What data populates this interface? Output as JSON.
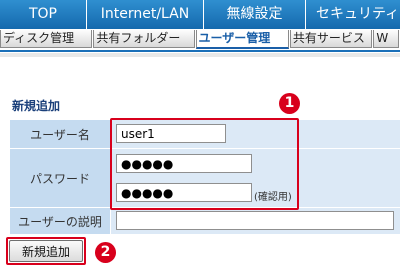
{
  "top_nav": {
    "tabs": [
      "TOP",
      "Internet/LAN",
      "無線設定",
      "セキュリティ"
    ]
  },
  "sub_nav": {
    "tabs": [
      "ディスク管理",
      "共有フォルダー",
      "ユーザー管理",
      "共有サービス",
      "W"
    ],
    "active": "ユーザー管理"
  },
  "section": {
    "title": "新規追加"
  },
  "form": {
    "username_label": "ユーザー名",
    "username_value": "user1",
    "password_label": "パスワード",
    "password_value": "●●●●●",
    "password_confirm_value": "●●●●●",
    "password_confirm_hint": "(確認用)",
    "description_label": "ユーザーの説明",
    "description_value": "",
    "submit_label": "新規追加"
  },
  "annotations": {
    "badge_1": "1",
    "badge_2": "2",
    "highlight_color": "#d8001c"
  },
  "colors": {
    "nav_blue": "#1a6fb8",
    "label_bg": "#c5dbf0",
    "value_bg": "#dce9f6"
  }
}
